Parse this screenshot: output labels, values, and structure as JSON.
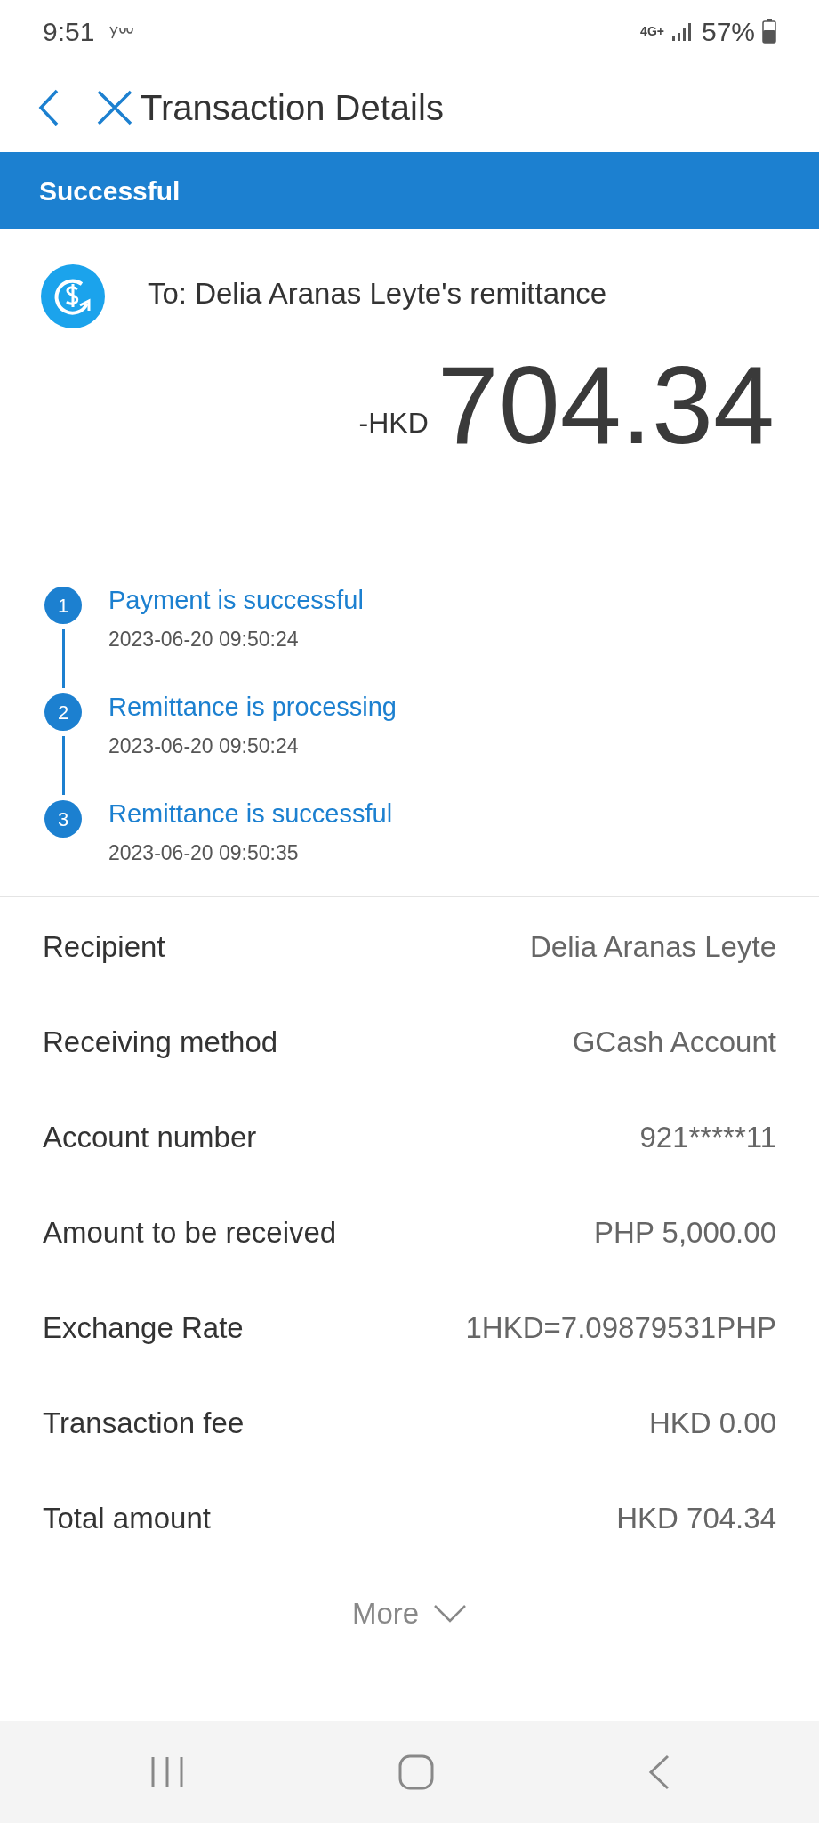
{
  "status_bar": {
    "time": "9:51",
    "network": "4G+",
    "battery": "57%"
  },
  "header": {
    "title": "Transaction Details"
  },
  "status_banner": {
    "label": "Successful"
  },
  "transaction": {
    "recipient_line": "To: Delia Aranas Leyte's remittance",
    "currency": "-HKD",
    "amount": "704.34"
  },
  "timeline": [
    {
      "number": "1",
      "label": "Payment is successful",
      "time": "2023-06-20 09:50:24"
    },
    {
      "number": "2",
      "label": "Remittance is processing",
      "time": "2023-06-20 09:50:24"
    },
    {
      "number": "3",
      "label": "Remittance is successful",
      "time": "2023-06-20 09:50:35"
    }
  ],
  "details": [
    {
      "label": "Recipient",
      "value": "Delia Aranas Leyte"
    },
    {
      "label": "Receiving method",
      "value": "GCash Account"
    },
    {
      "label": "Account number",
      "value": "921*****11"
    },
    {
      "label": "Amount to be received",
      "value": "PHP 5,000.00"
    },
    {
      "label": "Exchange Rate",
      "value": "1HKD=7.09879531PHP"
    },
    {
      "label": "Transaction fee",
      "value": "HKD 0.00"
    },
    {
      "label": "Total amount",
      "value": "HKD 704.34"
    }
  ],
  "more_button": {
    "label": "More"
  }
}
